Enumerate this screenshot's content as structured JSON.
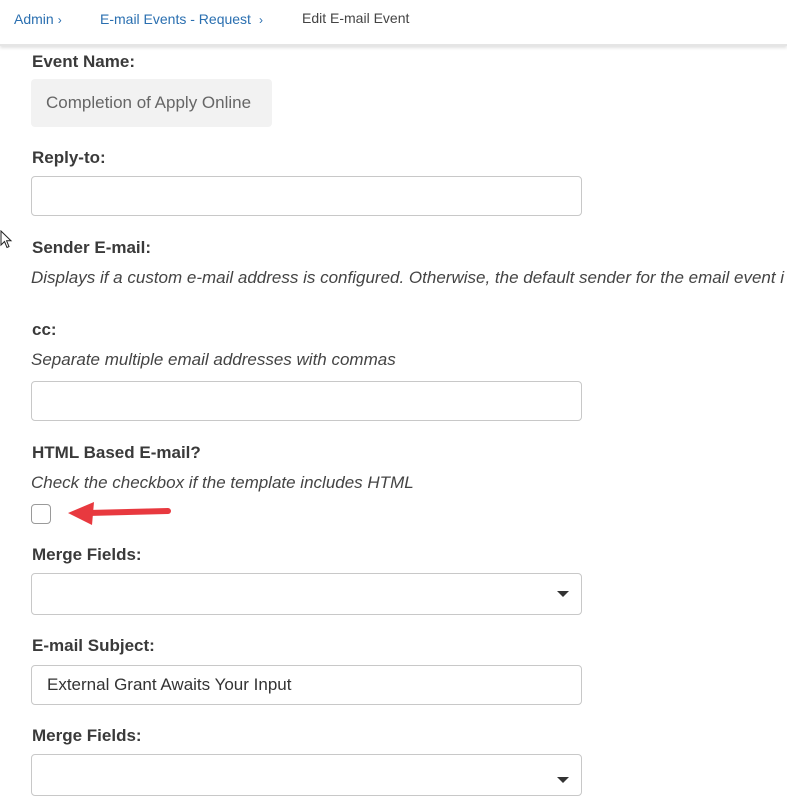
{
  "breadcrumb": {
    "items": [
      {
        "label": "Admin",
        "sep": "›"
      },
      {
        "label": "E-mail Events - Request",
        "sep": "›"
      }
    ],
    "current": "Edit E-mail Event"
  },
  "form": {
    "event_name": {
      "label": "Event Name:",
      "value": "Completion of Apply Online"
    },
    "reply_to": {
      "label": "Reply-to:",
      "value": ""
    },
    "sender_email": {
      "label": "Sender E-mail:",
      "help": "Displays if a custom e-mail address is configured. Otherwise, the default sender for the email event i"
    },
    "cc": {
      "label": "cc:",
      "help": "Separate multiple email addresses with commas",
      "value": ""
    },
    "html_based": {
      "label": "HTML Based E-mail?",
      "help": "Check the checkbox if the template includes HTML",
      "checked": false
    },
    "merge_fields_1": {
      "label": "Merge Fields:",
      "selected": ""
    },
    "email_subject": {
      "label": "E-mail Subject:",
      "value": "External Grant Awaits Your Input"
    },
    "merge_fields_2": {
      "label": "Merge Fields:",
      "selected": ""
    }
  },
  "colors": {
    "link": "#2a6fb0",
    "annotation_arrow": "#e8393f"
  },
  "icons": [
    "mouse-cursor-icon",
    "red-arrow-annotation-icon",
    "chevron-down-icon"
  ]
}
